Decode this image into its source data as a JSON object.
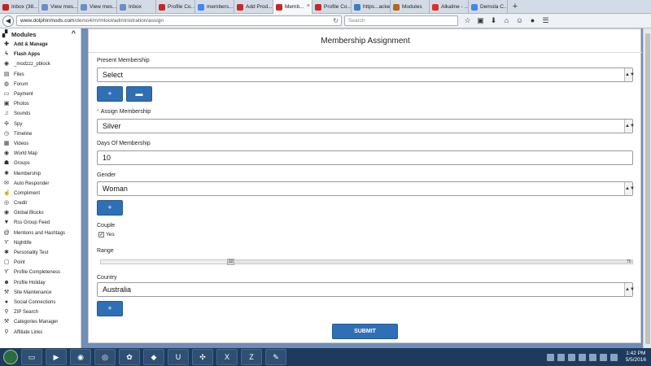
{
  "browser": {
    "tabs": [
      {
        "label": "Inbox (38...",
        "favicon_color": "#c5221f"
      },
      {
        "label": "View mes...",
        "favicon_color": "#6a8fc6"
      },
      {
        "label": "View mes...",
        "favicon_color": "#6a8fc6"
      },
      {
        "label": "Inbox",
        "favicon_color": "#6a8fc6"
      },
      {
        "label": "Profile Co...",
        "favicon_color": "#c62828"
      },
      {
        "label": "members...",
        "favicon_color": "#4285f4"
      },
      {
        "label": "Add Prod...",
        "favicon_color": "#c62828"
      },
      {
        "label": "Memb...",
        "favicon_color": "#c62828",
        "active": true
      },
      {
        "label": "Profile Co...",
        "favicon_color": "#c62828"
      },
      {
        "label": "https...acker",
        "favicon_color": "#3b7dc4"
      },
      {
        "label": "Modules",
        "favicon_color": "#b5651d"
      },
      {
        "label": "Alkaline - ...",
        "favicon_color": "#e52d27"
      },
      {
        "label": "Demola C...",
        "favicon_color": "#4285f4"
      }
    ],
    "newtab_label": "+",
    "tab_close_glyph": "×",
    "url_host": "www.dolphinmods.com",
    "url_path": "/demo4/m/mtool/administration/assign",
    "search_placeholder": "Search",
    "back_glyph": "◀",
    "reload_glyph": "↻",
    "toolbar_glyphs": [
      "☆",
      "▣",
      "⬇",
      "⌂",
      "☺",
      "●",
      "☰"
    ]
  },
  "sidebar": {
    "header": "Modules",
    "header_icon": "puzzle-icon",
    "collapse_glyph": "^",
    "items": [
      {
        "label": "Add & Manage",
        "icon": "plus-icon",
        "glyph": "✚",
        "bold": true
      },
      {
        "label": "Flash Apps",
        "icon": "bolt-icon",
        "glyph": "ϟ",
        "bold": true
      },
      {
        "label": "_modzzz_pblock",
        "icon": "globe-icon",
        "glyph": "◉"
      },
      {
        "label": "Files",
        "icon": "file-icon",
        "glyph": "▤"
      },
      {
        "label": "Forum",
        "icon": "comments-icon",
        "glyph": "◍"
      },
      {
        "label": "Payment",
        "icon": "credit-card-icon",
        "glyph": "▭"
      },
      {
        "label": "Photos",
        "icon": "photo-icon",
        "glyph": "▣"
      },
      {
        "label": "Sounds",
        "icon": "music-icon",
        "glyph": "♫"
      },
      {
        "label": "Spy",
        "icon": "crosshair-icon",
        "glyph": "✣"
      },
      {
        "label": "Timeline",
        "icon": "clock-icon",
        "glyph": "◷"
      },
      {
        "label": "Videos",
        "icon": "film-icon",
        "glyph": "▦"
      },
      {
        "label": "World Map",
        "icon": "globe-icon",
        "glyph": "◉"
      },
      {
        "label": "Groups",
        "icon": "users-icon",
        "glyph": "☗"
      },
      {
        "label": "Membership",
        "icon": "gear-icon",
        "glyph": "✺"
      },
      {
        "label": "Auto Responder",
        "icon": "envelope-icon",
        "glyph": "✉"
      },
      {
        "label": "Compliment",
        "icon": "thumbs-up-icon",
        "glyph": "☝"
      },
      {
        "label": "Credit",
        "icon": "coin-icon",
        "glyph": "◎"
      },
      {
        "label": "Global Blocks",
        "icon": "globe-icon",
        "glyph": "◉"
      },
      {
        "label": "Rss Group Feed",
        "icon": "filter-icon",
        "glyph": "▼"
      },
      {
        "label": "Mentions and Hashtags",
        "icon": "at-icon",
        "glyph": "@"
      },
      {
        "label": "Nightlife",
        "icon": "glass-icon",
        "glyph": "ϒ"
      },
      {
        "label": "Personality Test",
        "icon": "asterisk-icon",
        "glyph": "✱"
      },
      {
        "label": "Point",
        "icon": "square-icon",
        "glyph": "▢"
      },
      {
        "label": "Profile Completeness",
        "icon": "funnel-icon",
        "glyph": "ϒ"
      },
      {
        "label": "Profile Holiday",
        "icon": "user-icon",
        "glyph": "☻"
      },
      {
        "label": "Site Maintenance",
        "icon": "wrench-icon",
        "glyph": "⚒"
      },
      {
        "label": "Social Connections",
        "icon": "circle-icon",
        "glyph": "●"
      },
      {
        "label": "ZIP Search",
        "icon": "search-icon",
        "glyph": "⚲"
      },
      {
        "label": "Categories Manager",
        "icon": "wrench-icon",
        "glyph": "⚒"
      },
      {
        "label": "Affiliate Links",
        "icon": "search-icon",
        "glyph": "⚲"
      }
    ]
  },
  "form": {
    "title": "Membership Assignment",
    "present_membership": {
      "label": "Present Membership",
      "value": "Select"
    },
    "add_button_glyph": "+",
    "folder_button_glyph": "▬",
    "assign_membership": {
      "label": "Assign Membership",
      "required_mark": "*",
      "value": "Silver"
    },
    "days": {
      "label": "Days Of Membership",
      "value": "10"
    },
    "gender": {
      "label": "Gender",
      "value": "Woman"
    },
    "couple": {
      "label": "Couple",
      "option": "Yes",
      "checked": true,
      "check_glyph": "✓"
    },
    "range": {
      "label": "Range",
      "low": "32",
      "high": "75",
      "min": 18,
      "max": 75
    },
    "country": {
      "label": "Country",
      "value": "Australia"
    },
    "dropdown_glyph": "▲▼",
    "submit_label": "SUBMIT"
  },
  "taskbar": {
    "apps": [
      {
        "name": "folder-app-icon",
        "glyph": "▭"
      },
      {
        "name": "media-player-icon",
        "glyph": "▶"
      },
      {
        "name": "firefox-icon",
        "glyph": "◉"
      },
      {
        "name": "chrome-icon",
        "glyph": "◎"
      },
      {
        "name": "frog-app-icon",
        "glyph": "✿"
      },
      {
        "name": "eraser-app-icon",
        "glyph": "◆"
      },
      {
        "name": "ue-app-icon",
        "glyph": "U"
      },
      {
        "name": "network-app-icon",
        "glyph": "✣"
      },
      {
        "name": "excel-icon",
        "glyph": "X"
      },
      {
        "name": "filezilla-icon",
        "glyph": "Z"
      },
      {
        "name": "tools-app-icon",
        "glyph": "✎"
      }
    ],
    "time": "1:42 PM",
    "date": "5/5/2016"
  },
  "colors": {
    "primary": "#2f6fb5",
    "frame": "#6f8eb8",
    "taskbar": "#1e3a5c"
  }
}
